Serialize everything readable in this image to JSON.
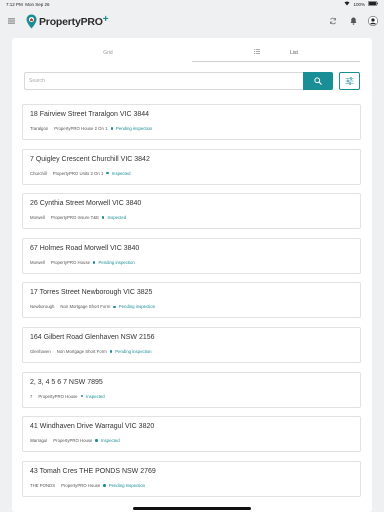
{
  "status_bar": {
    "time": "7:12 PM",
    "date": "Mon Sep 26",
    "battery": "100%"
  },
  "header": {
    "logo_text_bold": "Property",
    "logo_text_rest": "PRO",
    "logo_plus": "+"
  },
  "tabs": [
    {
      "label": "Grid",
      "active": false
    },
    {
      "label": "List",
      "active": true
    }
  ],
  "search": {
    "placeholder": "Search",
    "value": ""
  },
  "accent_color": "#1a8e95",
  "properties": [
    {
      "address": "18 Fairview Street Traralgon VIC 3844",
      "suburb": "Traralgon",
      "type": "PropertyPRO House 2 On 1",
      "status": "Pending inspection"
    },
    {
      "address": "7 Quigley Crescent Churchill VIC 3842",
      "suburb": "Churchill",
      "type": "PropertyPRO Units 2 On 1",
      "status": "Inspected"
    },
    {
      "address": "26 Cynthia Street Morwell VIC 3840",
      "suburb": "Morwell",
      "type": "PropertyPRO Insure T&E",
      "status": "Inspected"
    },
    {
      "address": "67 Holmes Road Morwell VIC 3840",
      "suburb": "Morwell",
      "type": "PropertyPRO House",
      "status": "Pending inspection"
    },
    {
      "address": "17 Torres  Street Newborough VIC 3825",
      "suburb": "Newborough",
      "type": "Non Mortgage Short Form",
      "status": "Pending inspection"
    },
    {
      "address": "164 Gilbert  Road Glenhaven NSW 2156",
      "suburb": "Glenhaven",
      "type": "Non Mortgage Short Form",
      "status": "Pending inspection"
    },
    {
      "address": "2, 3, 4 5 6 7 NSW 7895",
      "suburb": "7",
      "type": "PropertyPRO House",
      "status": "Inspected"
    },
    {
      "address": "41 Windhaven Drive Warragul VIC 3820",
      "suburb": "Warragul",
      "type": "PropertyPRO House",
      "status": "Inspected"
    },
    {
      "address": "43 Tomah Cres THE PONDS NSW 2769",
      "suburb": "THE PONDS",
      "type": "PropertyPRO House",
      "status": "Pending inspection"
    }
  ]
}
